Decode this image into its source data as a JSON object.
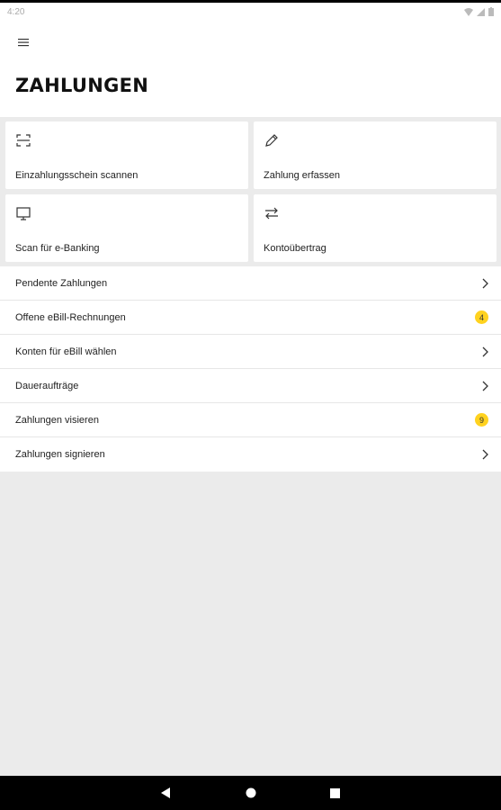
{
  "status_bar": {
    "time": "4:20"
  },
  "header": {
    "title": "ZAHLUNGEN"
  },
  "tiles": [
    {
      "label": "Einzahlungsschein scannen",
      "icon": "scan-icon"
    },
    {
      "label": "Zahlung erfassen",
      "icon": "pencil-icon"
    },
    {
      "label": "Scan für e-Banking",
      "icon": "monitor-icon"
    },
    {
      "label": "Kontoübertrag",
      "icon": "transfer-icon"
    }
  ],
  "list": [
    {
      "label": "Pendente Zahlungen",
      "badge": null
    },
    {
      "label": "Offene eBill-Rechnungen",
      "badge": "4"
    },
    {
      "label": "Konten für eBill wählen",
      "badge": null
    },
    {
      "label": "Daueraufträge",
      "badge": null
    },
    {
      "label": "Zahlungen visieren",
      "badge": "9"
    },
    {
      "label": "Zahlungen signieren",
      "badge": null
    }
  ],
  "colors": {
    "accent": "#ffd21f",
    "background": "#ebebeb"
  }
}
